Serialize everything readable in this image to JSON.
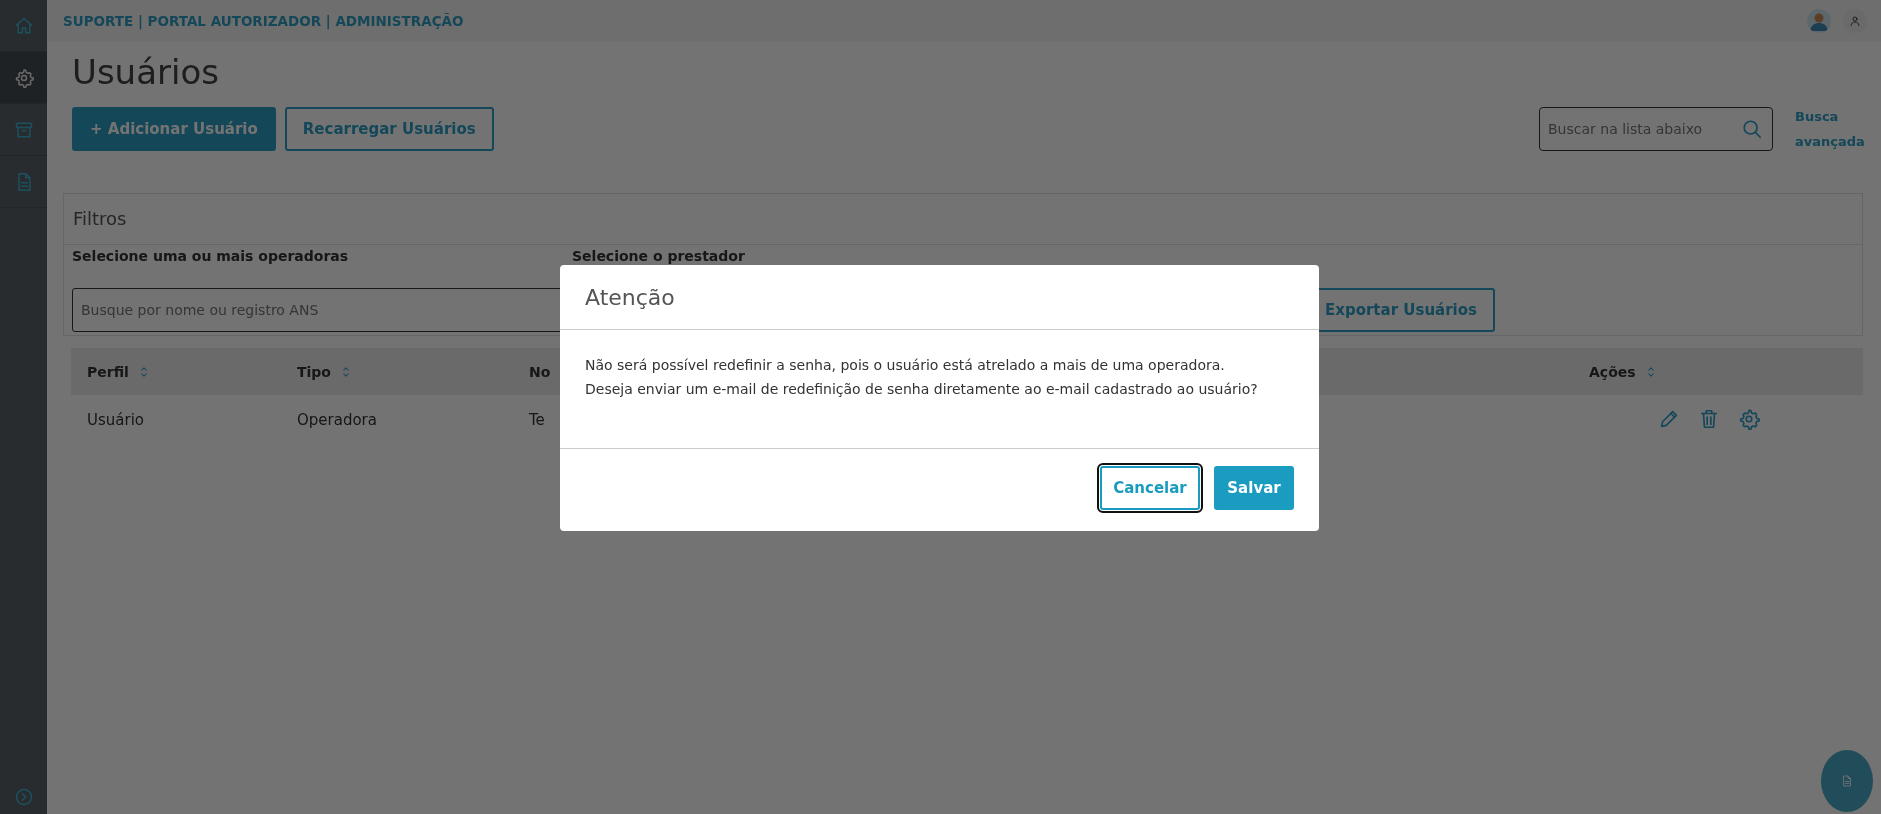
{
  "breadcrumb": "SUPORTE | PORTAL AUTORIZADOR | ADMINISTRAÇÃO",
  "sidebar": {
    "items": [
      {
        "kind": "home",
        "selected": false
      },
      {
        "kind": "gear",
        "selected": true
      },
      {
        "kind": "archive",
        "selected": false
      },
      {
        "kind": "document",
        "selected": false
      }
    ]
  },
  "page_title": "Usuários",
  "actions": [
    {
      "label": "+ Adicionar Usuário",
      "kind": "primary"
    },
    {
      "label": "Recarregar Usuários",
      "kind": "outline"
    }
  ],
  "search": {
    "placeholder": "Buscar na lista abaixo"
  },
  "advanced_search": "Busca avançada",
  "filters": {
    "title": "Filtros",
    "fields": [
      {
        "label": "Selecione uma ou mais operadoras",
        "placeholder": "Busque por nome ou registro ANS"
      },
      {
        "label": "Selecione o prestador"
      }
    ],
    "export_button": "Exportar Usuários"
  },
  "table": {
    "columns": [
      {
        "label": "Perfil",
        "sortable": true
      },
      {
        "label": "Tipo",
        "sortable": true
      },
      {
        "label": "No",
        "sortable": false
      },
      {
        "label": "Ações",
        "sortable": true
      }
    ],
    "rows": [
      {
        "cells": [
          "Usuário",
          "Operadora",
          "Te"
        ],
        "actions": [
          {
            "kind": "edit"
          },
          {
            "kind": "delete"
          },
          {
            "kind": "settings"
          }
        ]
      }
    ]
  },
  "dialog": {
    "title": "Atenção",
    "message_lines": [
      "Não será possível redefinir a senha, pois o usuário está atrelado a mais de uma operadora.",
      "Deseja enviar um e-mail de redefinição de senha diretamente ao e-mail cadastrado ao usuário?"
    ],
    "buttons": [
      {
        "label": "Cancelar",
        "kind": "secondary",
        "focused": true
      },
      {
        "label": "Salvar",
        "kind": "primary",
        "focused": false
      }
    ]
  }
}
